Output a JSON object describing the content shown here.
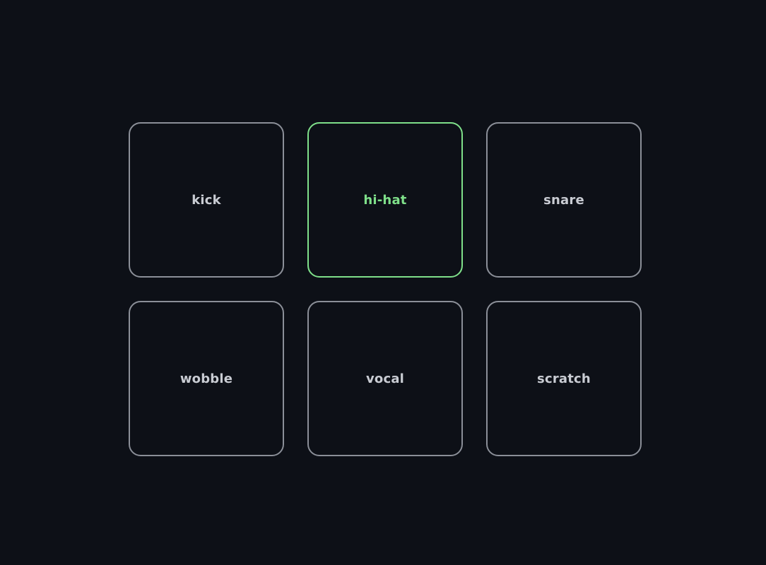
{
  "pads": [
    {
      "label": "kick",
      "active": false
    },
    {
      "label": "hi-hat",
      "active": true
    },
    {
      "label": "snare",
      "active": false
    },
    {
      "label": "wobble",
      "active": false
    },
    {
      "label": "vocal",
      "active": false
    },
    {
      "label": "scratch",
      "active": false
    }
  ],
  "colors": {
    "background": "#0d1017",
    "pad_border": "#8b8f98",
    "pad_text": "#c9ccd3",
    "active_accent": "#7fe08a"
  }
}
